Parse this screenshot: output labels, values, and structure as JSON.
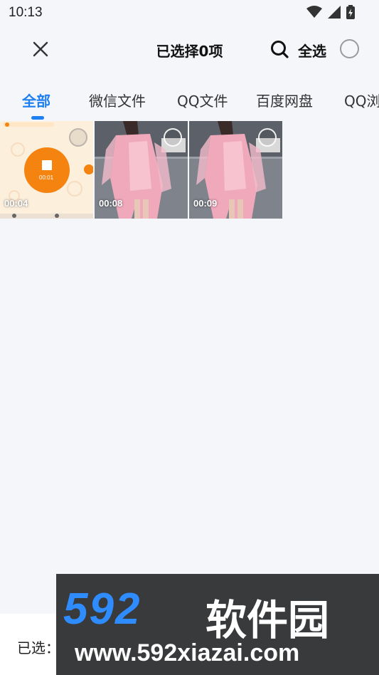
{
  "status": {
    "time": "10:13"
  },
  "header": {
    "title": "已选择0项",
    "select_all_label": "全选"
  },
  "tabs": [
    {
      "label": "全部",
      "active": true
    },
    {
      "label": "微信文件",
      "active": false
    },
    {
      "label": "QQ文件",
      "active": false
    },
    {
      "label": "百度网盘",
      "active": false
    },
    {
      "label": "QQ浏",
      "active": false
    }
  ],
  "videos": [
    {
      "duration": "00:04",
      "inner_timer": "00:01"
    },
    {
      "duration": "00:08"
    },
    {
      "duration": "00:09"
    }
  ],
  "bottom": {
    "selected_label": "已选："
  },
  "watermark": {
    "brand": "592",
    "brand_cn": "软件园",
    "url": "www.592xiazai.com"
  },
  "colors": {
    "accent": "#1e7ff0",
    "background": "#f4f6fa",
    "orange": "#f5830f"
  }
}
